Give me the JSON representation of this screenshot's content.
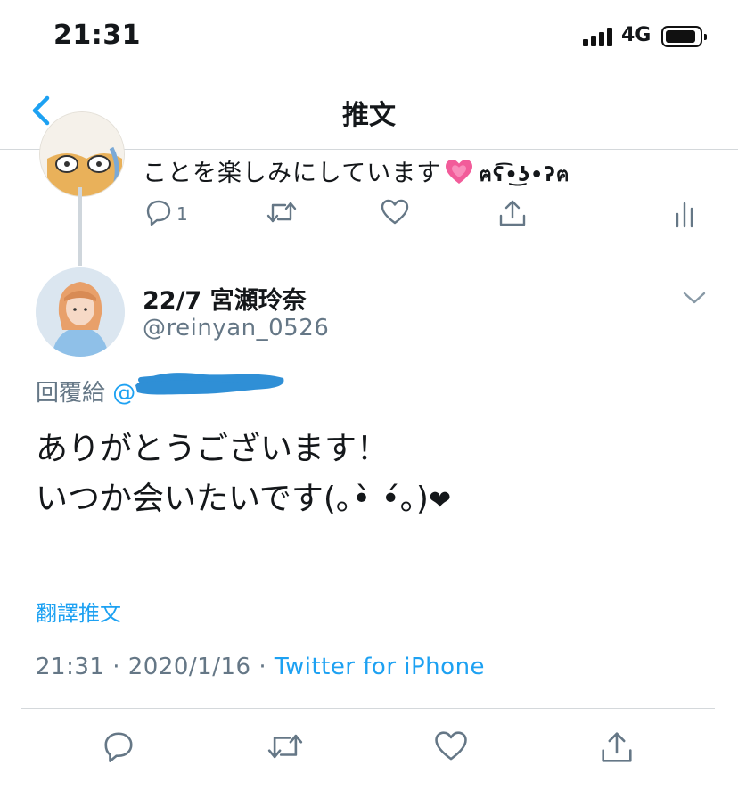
{
  "status_bar": {
    "time": "21:31",
    "network": "4G"
  },
  "nav": {
    "title": "推文"
  },
  "previous_tweet": {
    "text": "ことを楽しみにしています",
    "kaomoji": "ฅʕ͡•͜ʖ•ʔฅ",
    "reply_count": "1"
  },
  "tweet": {
    "display_name": "22/7 宮瀬玲奈",
    "handle": "@reinyan_0526",
    "reply_prefix": "回覆給",
    "reply_mention_visible": "@",
    "line1": "ありがとうございます！",
    "line2": "いつか会いたいです(｡•̀ •́｡)",
    "line2_heart": "❤",
    "translate_label": "翻譯推文",
    "time": "21:31",
    "date": "2020/1/16",
    "separator": "·",
    "source": "Twitter for iPhone"
  },
  "colors": {
    "accent": "#1da1f2",
    "secondary_text": "#657786",
    "redaction": "#2f8fd6",
    "heart": "#f25c9a"
  },
  "icons": [
    "back-chevron-icon",
    "reply-icon",
    "retweet-icon",
    "like-icon",
    "share-icon",
    "analytics-icon",
    "caret-down-icon"
  ]
}
